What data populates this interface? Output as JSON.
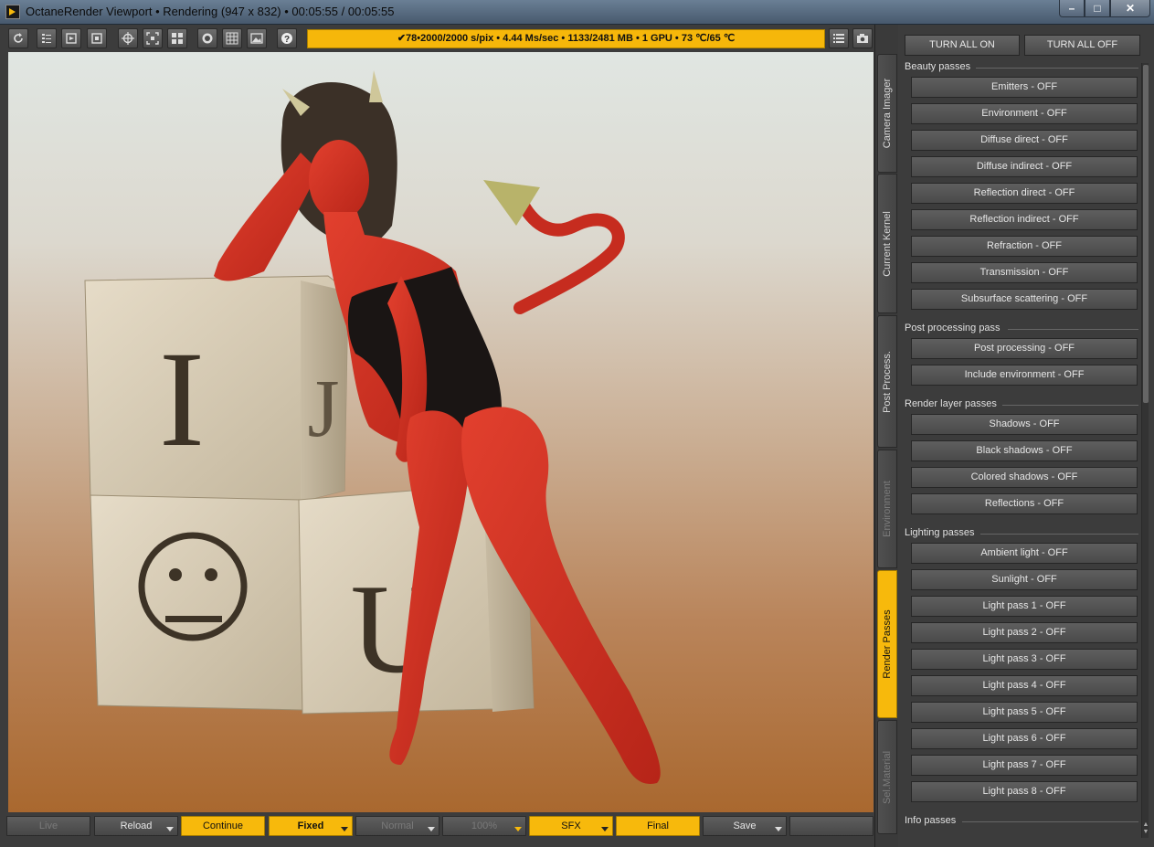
{
  "window": {
    "title": "OctaneRender Viewport • Rendering (947 x 832) • 00:05:55 / 00:05:55",
    "controls": {
      "minimize": "–",
      "maximize": "□",
      "close": "✕"
    }
  },
  "toolbar": {
    "icons": [
      "refresh-icon",
      "layers-icon",
      "export-icon",
      "settings-icon",
      "target-icon",
      "focus-icon",
      "grid-icon",
      "sphere-icon",
      "mesh-icon",
      "image-icon",
      "help-icon",
      "list-icon",
      "camera-icon"
    ],
    "status": "✔78•2000/2000 s/pix • 4.44 Ms/sec • 1133/2481 MB • 1 GPU • 73 ℃/65 ℃"
  },
  "bottom_bar": {
    "live": "Live",
    "reload": "Reload",
    "continue": "Continue",
    "fixed": "Fixed",
    "normal": "Normal",
    "zoom": "100%",
    "sfx": "SFX",
    "final": "Final",
    "save": "Save"
  },
  "tabs": {
    "camera_imager": "Camera Imager",
    "current_kernel": "Current Kernel",
    "post_process": "Post Process.",
    "environment": "Environment",
    "render_passes": "Render Passes",
    "sel_material": "Sel.Material",
    "active": "Render Passes"
  },
  "panel": {
    "turn_all_on": "TURN ALL ON",
    "turn_all_off": "TURN ALL OFF",
    "sections": {
      "beauty": {
        "title": "Beauty passes",
        "items": [
          "Emitters - OFF",
          "Environment - OFF",
          "Diffuse direct - OFF",
          "Diffuse indirect - OFF",
          "Reflection direct - OFF",
          "Reflection indirect - OFF",
          "Refraction - OFF",
          "Transmission - OFF",
          "Subsurface scattering - OFF"
        ]
      },
      "post": {
        "title": "Post processing pass",
        "items": [
          "Post processing - OFF",
          "Include environment - OFF"
        ]
      },
      "layer": {
        "title": "Render layer passes",
        "items": [
          "Shadows - OFF",
          "Black shadows - OFF",
          "Colored shadows - OFF",
          "Reflections - OFF"
        ]
      },
      "lighting": {
        "title": "Lighting passes",
        "items": [
          "Ambient light - OFF",
          "Sunlight - OFF",
          "Light pass 1 - OFF",
          "Light pass 2 - OFF",
          "Light pass 3 - OFF",
          "Light pass 4 - OFF",
          "Light pass 5 - OFF",
          "Light pass 6 - OFF",
          "Light pass 7 - OFF",
          "Light pass 8 - OFF"
        ]
      },
      "info": {
        "title": "Info passes"
      }
    }
  },
  "render": {
    "block_letters": {
      "top_left": "I",
      "top_right": "J",
      "bottom_right": "U"
    },
    "colors": {
      "skin": "#d9322a",
      "block": "#d8cdb8",
      "accent": "#f7b90c"
    }
  }
}
